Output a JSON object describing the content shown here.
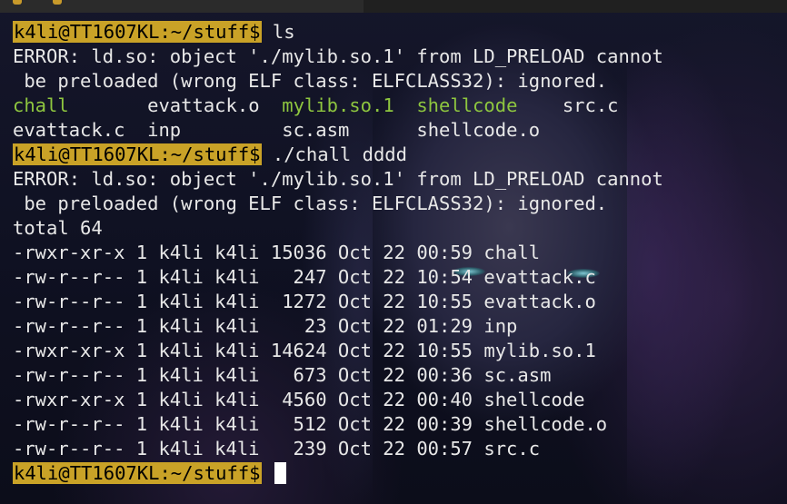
{
  "prompt": "k4li@TT1607KL:~/stuff$",
  "cmd1": " ls",
  "error1": "ERROR: ld.so: object './mylib.so.1' from LD_PRELOAD cannot",
  "error2": " be preloaded (wrong ELF class: ELFCLASS32): ignored.",
  "ls_row1": [
    {
      "text": "chall",
      "type": "exec"
    },
    {
      "text": "       ",
      "type": "plain"
    },
    {
      "text": "evattack.o",
      "type": "plain"
    },
    {
      "text": "  ",
      "type": "plain"
    },
    {
      "text": "mylib.so.1",
      "type": "exec"
    },
    {
      "text": "  ",
      "type": "plain"
    },
    {
      "text": "shellcode",
      "type": "exec"
    },
    {
      "text": "    ",
      "type": "plain"
    },
    {
      "text": "src.c",
      "type": "plain"
    }
  ],
  "ls_row2": [
    {
      "text": "evattack.c",
      "type": "plain"
    },
    {
      "text": "  ",
      "type": "plain"
    },
    {
      "text": "inp",
      "type": "plain"
    },
    {
      "text": "         ",
      "type": "plain"
    },
    {
      "text": "sc.asm",
      "type": "plain"
    },
    {
      "text": "      ",
      "type": "plain"
    },
    {
      "text": "shellcode.o",
      "type": "plain"
    }
  ],
  "cmd2": " ./chall dddd",
  "total": "total 64",
  "listing": [
    "-rwxr-xr-x 1 k4li k4li 15036 Oct 22 00:59 chall",
    "-rw-r--r-- 1 k4li k4li   247 Oct 22 10:54 evattack.c",
    "-rw-r--r-- 1 k4li k4li  1272 Oct 22 10:55 evattack.o",
    "-rw-r--r-- 1 k4li k4li    23 Oct 22 01:29 inp",
    "-rwxr-xr-x 1 k4li k4li 14624 Oct 22 10:55 mylib.so.1",
    "-rw-r--r-- 1 k4li k4li   673 Oct 22 00:36 sc.asm",
    "-rwxr-xr-x 1 k4li k4li  4560 Oct 22 00:40 shellcode",
    "-rw-r--r-- 1 k4li k4li   512 Oct 22 00:39 shellcode.o",
    "-rw-r--r-- 1 k4li k4li   239 Oct 22 00:57 src.c"
  ],
  "colors": {
    "prompt_bg": "#c9a227",
    "exec_file": "#8ec63f",
    "text": "#e8e8e8"
  }
}
